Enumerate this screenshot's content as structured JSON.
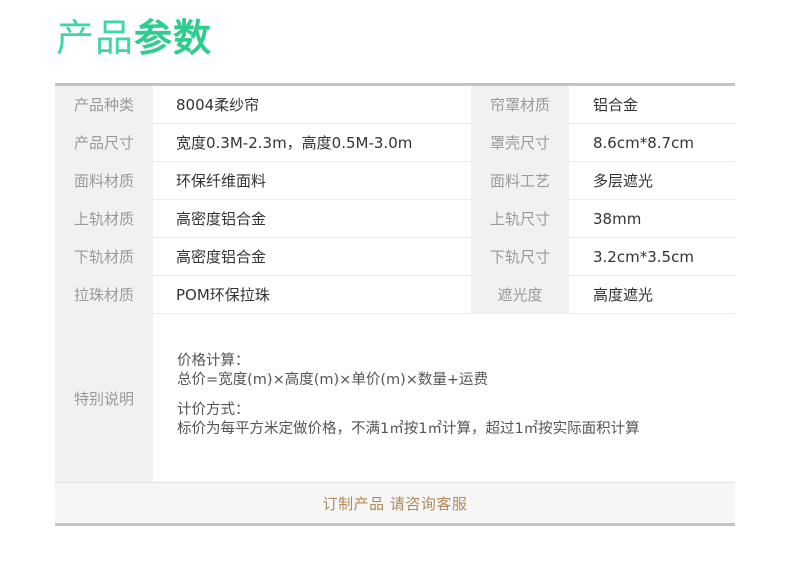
{
  "title": {
    "light": "产品",
    "bold": "参数"
  },
  "rows": [
    {
      "l1": "产品种类",
      "v1": "8004柔纱帘",
      "l2": "帘罩材质",
      "v2": "铝合金"
    },
    {
      "l1": "产品尺寸",
      "v1": "宽度0.3M-2.3m，高度0.5M-3.0m",
      "l2": "罩壳尺寸",
      "v2": "8.6cm*8.7cm"
    },
    {
      "l1": "面料材质",
      "v1": "环保纤维面料",
      "l2": "面料工艺",
      "v2": "多层遮光"
    },
    {
      "l1": "上轨材质",
      "v1": "高密度铝合金",
      "l2": "上轨尺寸",
      "v2": "38mm"
    },
    {
      "l1": "下轨材质",
      "v1": "高密度铝合金",
      "l2": "下轨尺寸",
      "v2": "3.2cm*3.5cm"
    },
    {
      "l1": "拉珠材质",
      "v1": "POM环保拉珠",
      "l2": "遮光度",
      "v2": "高度遮光"
    }
  ],
  "special": {
    "label": "特别说明",
    "lines": [
      "价格计算：",
      "总价=宽度(m)×高度(m)×单价(m)×数量+运费",
      "计价方式：",
      "标价为每平方米定做价格，不满1㎡按1㎡计算，超过1㎡按实际面积计算"
    ]
  },
  "footer": {
    "text": "订制产品 请咨询客服"
  },
  "colors": {
    "accent": "#2ecc8f",
    "footer_text": "#b08a5a",
    "label_bg": "#f1f1f1"
  }
}
